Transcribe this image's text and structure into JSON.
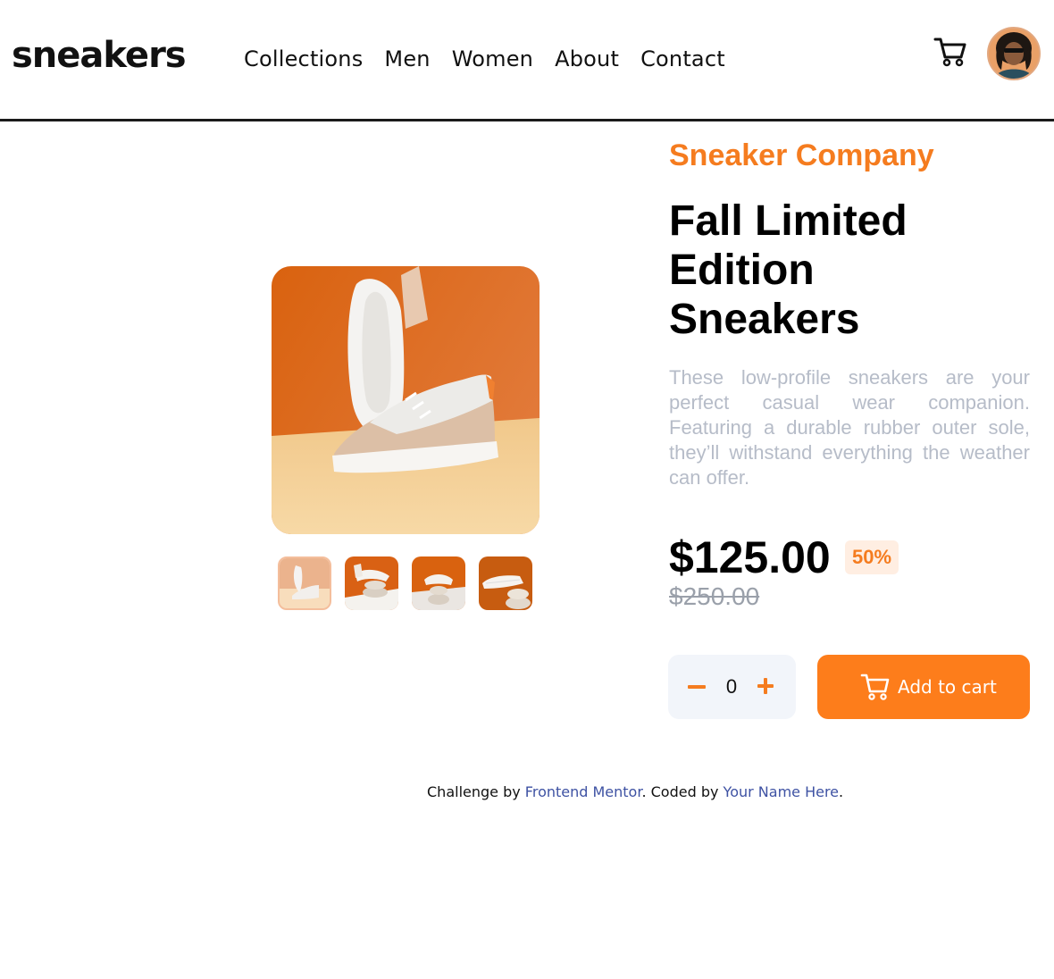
{
  "brand": {
    "logo": "sneakers"
  },
  "nav": {
    "items": [
      "Collections",
      "Men",
      "Women",
      "About",
      "Contact"
    ]
  },
  "icons": {
    "cart": "cart-icon",
    "avatar": "user-avatar"
  },
  "gallery": {
    "main_image": "sneaker-product-photo-1",
    "thumbnails": [
      {
        "image": "sneaker-thumbnail-1",
        "active": true
      },
      {
        "image": "sneaker-thumbnail-2",
        "active": false
      },
      {
        "image": "sneaker-thumbnail-3",
        "active": false
      },
      {
        "image": "sneaker-thumbnail-4",
        "active": false
      }
    ]
  },
  "product": {
    "company": "Sneaker Company",
    "title": "Fall Limited Edition Sneakers",
    "description": "These low-profile sneakers are your perfect casual wear companion. Featuring a durable rubber outer sole, they’ll withstand everything the weather can offer.",
    "price": "$125.00",
    "discount": "50%",
    "original_price": "$250.00"
  },
  "quantity": {
    "value": "0"
  },
  "cart_button": {
    "label": "Add to cart"
  },
  "footer": {
    "prefix": "Challenge by ",
    "link1": "Frontend Mentor",
    "middle": ". Coded by ",
    "link2": "Your Name Here",
    "suffix": "."
  },
  "colors": {
    "accent": "#fd7d1b",
    "accent_light": "#ffeee2",
    "text_muted": "#b6bcc8",
    "link": "#3e52a3",
    "qty_bg": "#f2f5fa"
  }
}
